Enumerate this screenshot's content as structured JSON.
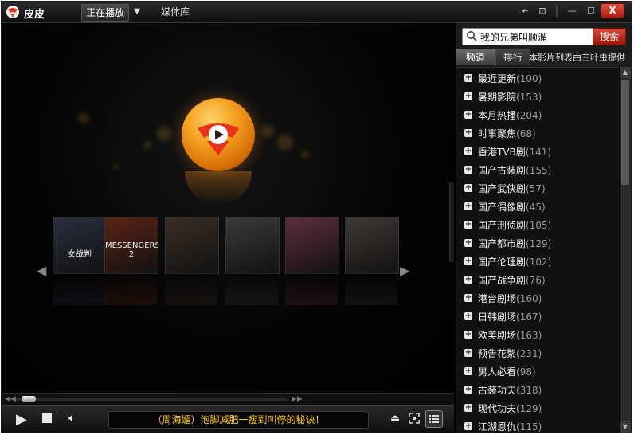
{
  "app": {
    "name": "皮皮"
  },
  "titlebar": {
    "tab_now_playing": "正在播放",
    "tab_library": "媒体库",
    "close_label": "X"
  },
  "video": {
    "posters": [
      {
        "title": "女战判",
        "bg": "#2b2f3e"
      },
      {
        "title": "MESSENGERS 2",
        "bg": "#5a2416"
      },
      {
        "title": "",
        "bg": "#3a2f27"
      },
      {
        "title": "",
        "bg": "#3b3b3b"
      },
      {
        "title": "",
        "bg": "#5e2e3e"
      },
      {
        "title": "",
        "bg": "#3f3a35"
      }
    ]
  },
  "player": {
    "marquee": "（周海媚）泡脚减肥一瘦到叫停的秘诀！",
    "progress": 0.02
  },
  "panel": {
    "search_value": "我的兄弟叫顺溜",
    "search_button": "搜索",
    "tabs": [
      {
        "label": "频道"
      },
      {
        "label": "排行"
      }
    ],
    "tab_note": "本影片列表由三叶虫提供",
    "categories": [
      {
        "name": "最近更新",
        "count": "(100)"
      },
      {
        "name": "暑期影院",
        "count": "(153)"
      },
      {
        "name": "本月热播",
        "count": "(204)"
      },
      {
        "name": "时事聚焦",
        "count": "(68)"
      },
      {
        "name": "香港TVB剧",
        "count": "(141)"
      },
      {
        "name": "国产古装剧",
        "count": "(155)"
      },
      {
        "name": "国产武侠剧",
        "count": "(57)"
      },
      {
        "name": "国产偶像剧",
        "count": "(45)"
      },
      {
        "name": "国产刑侦剧",
        "count": "(105)"
      },
      {
        "name": "国产都市剧",
        "count": "(129)"
      },
      {
        "name": "国产伦理剧",
        "count": "(102)"
      },
      {
        "name": "国产战争剧",
        "count": "(76)"
      },
      {
        "name": "港台剧场",
        "count": "(160)"
      },
      {
        "name": "日韩剧场",
        "count": "(167)"
      },
      {
        "name": "欧美剧场",
        "count": "(163)"
      },
      {
        "name": "预告花絮",
        "count": "(231)"
      },
      {
        "name": "男人必看",
        "count": "(98)"
      },
      {
        "name": "古装功夫",
        "count": "(318)"
      },
      {
        "name": "现代功夫",
        "count": "(129)"
      },
      {
        "name": "江湖恩仇",
        "count": "(115)"
      }
    ]
  }
}
